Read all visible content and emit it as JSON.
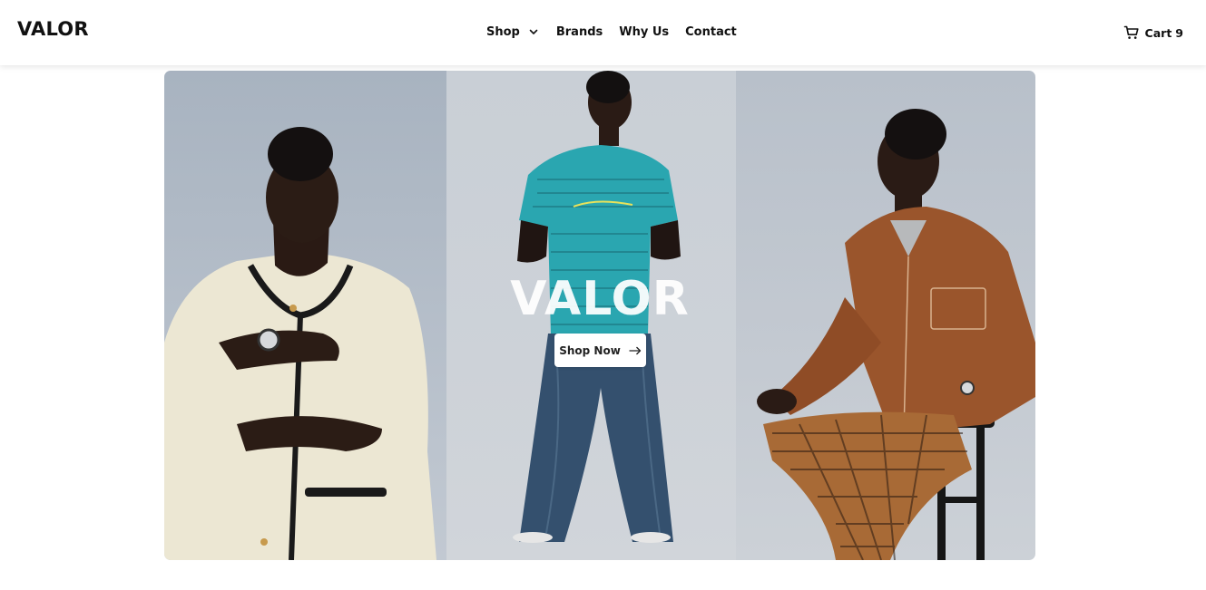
{
  "header": {
    "logo": "VALOR",
    "nav": [
      {
        "label": "Shop",
        "has_dropdown": true
      },
      {
        "label": "Brands"
      },
      {
        "label": "Why Us"
      },
      {
        "label": "Contact"
      }
    ],
    "cart": {
      "label": "Cart",
      "count": "9",
      "icon": "cart-icon"
    }
  },
  "hero": {
    "title": "VALOR",
    "cta_label": "Shop Now",
    "cta_icon": "arrow-right-icon",
    "images": [
      {
        "name": "model-cream-jacket-photo"
      },
      {
        "name": "model-striped-tee-photo"
      },
      {
        "name": "model-brown-shirt-photo"
      }
    ]
  },
  "colors": {
    "header_bg": "#ffffff",
    "text": "#111111",
    "hero_backdrop": "#c3c9d1",
    "cta_bg": "#ffffff"
  }
}
